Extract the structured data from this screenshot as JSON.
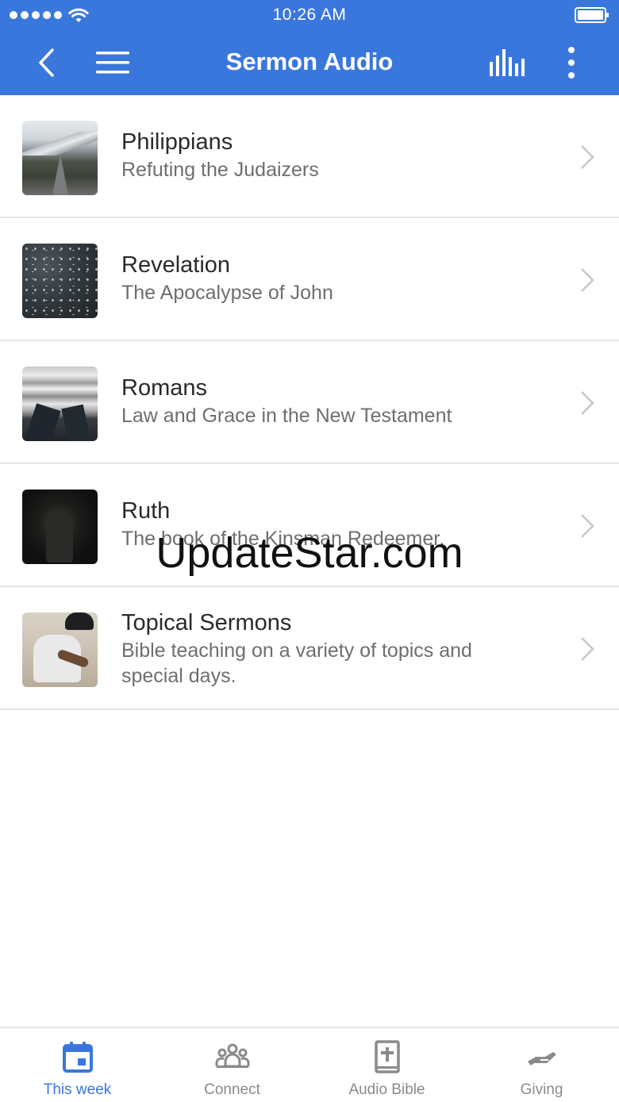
{
  "status_bar": {
    "time": "10:26 AM"
  },
  "app_bar": {
    "title": "Sermon Audio"
  },
  "sermons": [
    {
      "title": "Philippians",
      "subtitle": "Refuting the Judaizers",
      "thumb": "mountain-road"
    },
    {
      "title": "Revelation",
      "subtitle": "The Apocalypse of John",
      "thumb": "falling-snow"
    },
    {
      "title": "Romans",
      "subtitle": "Law and Grace in the New Testament",
      "thumb": "legs-over-city"
    },
    {
      "title": "Ruth",
      "subtitle": "The book of the Kinsman Redeemer.",
      "thumb": "person-in-dark"
    },
    {
      "title": "Topical Sermons",
      "subtitle": "Bible teaching on a variety of topics and special days.",
      "thumb": "person-writing"
    }
  ],
  "watermark": "UpdateStar.com",
  "tabs": [
    {
      "label": "This week",
      "icon": "calendar-icon",
      "active": true
    },
    {
      "label": "Connect",
      "icon": "group-icon",
      "active": false
    },
    {
      "label": "Audio Bible",
      "icon": "bible-icon",
      "active": false
    },
    {
      "label": "Giving",
      "icon": "giving-hand-icon",
      "active": false
    }
  ],
  "colors": {
    "accent": "#3a77dd",
    "inactive": "#8a8a8a",
    "divider": "#e4e4e4"
  }
}
